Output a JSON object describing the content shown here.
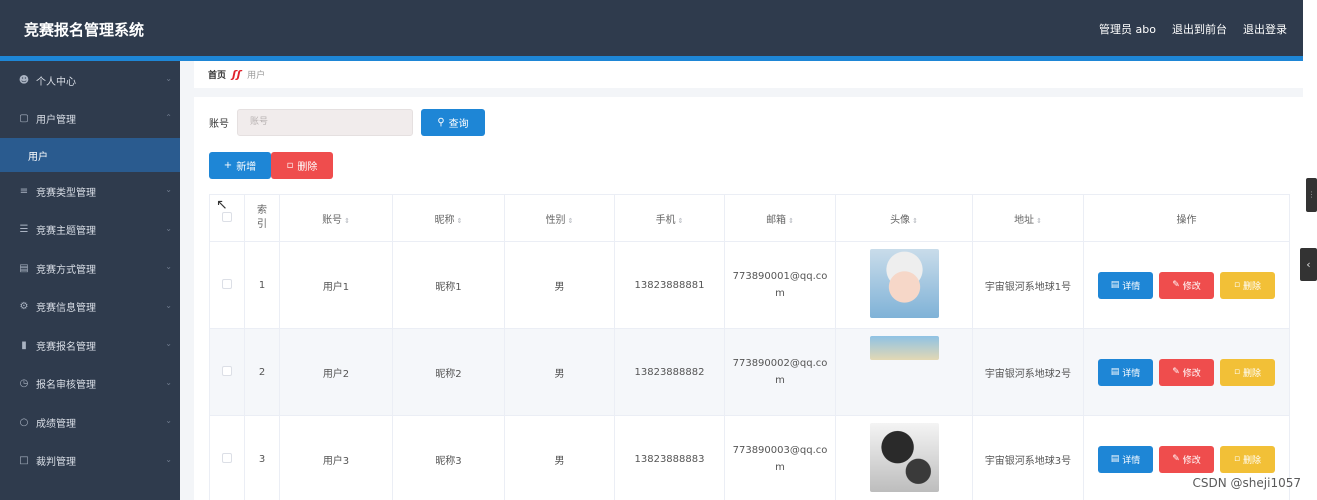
{
  "header": {
    "title": "竞赛报名管理系统",
    "admin_label": "管理员 abo",
    "to_front": "退出到前台",
    "logout": "退出登录"
  },
  "sidebar": {
    "items": [
      {
        "label": "个人中心",
        "icon": "user-icon"
      },
      {
        "label": "用户管理",
        "icon": "users-icon",
        "expanded": true
      },
      {
        "label": "竞赛类型管理",
        "icon": "sliders-icon"
      },
      {
        "label": "竞赛主题管理",
        "icon": "list-icon"
      },
      {
        "label": "竞赛方式管理",
        "icon": "clipboard-icon"
      },
      {
        "label": "竞赛信息管理",
        "icon": "settings-icon"
      },
      {
        "label": "竞赛报名管理",
        "icon": "bar-chart-icon"
      },
      {
        "label": "报名审核管理",
        "icon": "clock-icon"
      },
      {
        "label": "成绩管理",
        "icon": "medal-icon"
      },
      {
        "label": "裁判管理",
        "icon": "frame-icon"
      }
    ],
    "sub_item": "用户"
  },
  "breadcrumb": {
    "home": "首页",
    "current": "用户"
  },
  "search": {
    "label": "账号",
    "placeholder": "账号",
    "button": "查询"
  },
  "actions": {
    "add": "新增",
    "delete": "删除"
  },
  "table": {
    "headers": {
      "index": "索引",
      "account": "账号",
      "nickname": "昵称",
      "gender": "性别",
      "phone": "手机",
      "email": "邮箱",
      "avatar": "头像",
      "address": "地址",
      "ops": "操作"
    },
    "rows": [
      {
        "index": "1",
        "account": "用户1",
        "nickname": "昵称1",
        "gender": "男",
        "phone": "13823888881",
        "email_a": "773890001@qq.co",
        "email_b": "m",
        "address": "宇宙银河系地球1号"
      },
      {
        "index": "2",
        "account": "用户2",
        "nickname": "昵称2",
        "gender": "男",
        "phone": "13823888882",
        "email_a": "773890002@qq.co",
        "email_b": "m",
        "address": "宇宙银河系地球2号"
      },
      {
        "index": "3",
        "account": "用户3",
        "nickname": "昵称3",
        "gender": "男",
        "phone": "13823888883",
        "email_a": "773890003@qq.co",
        "email_b": "m",
        "address": "宇宙银河系地球3号"
      }
    ],
    "row_buttons": {
      "detail": "详情",
      "edit": "修改",
      "delete": "删除"
    }
  },
  "watermark": "CSDN @sheji1057",
  "colors": {
    "header_bg": "#2f3b4d",
    "accent": "#1e86d6",
    "danger": "#ef4d4d",
    "warning": "#f2c037",
    "sidebar_active": "#2a5b8f"
  }
}
